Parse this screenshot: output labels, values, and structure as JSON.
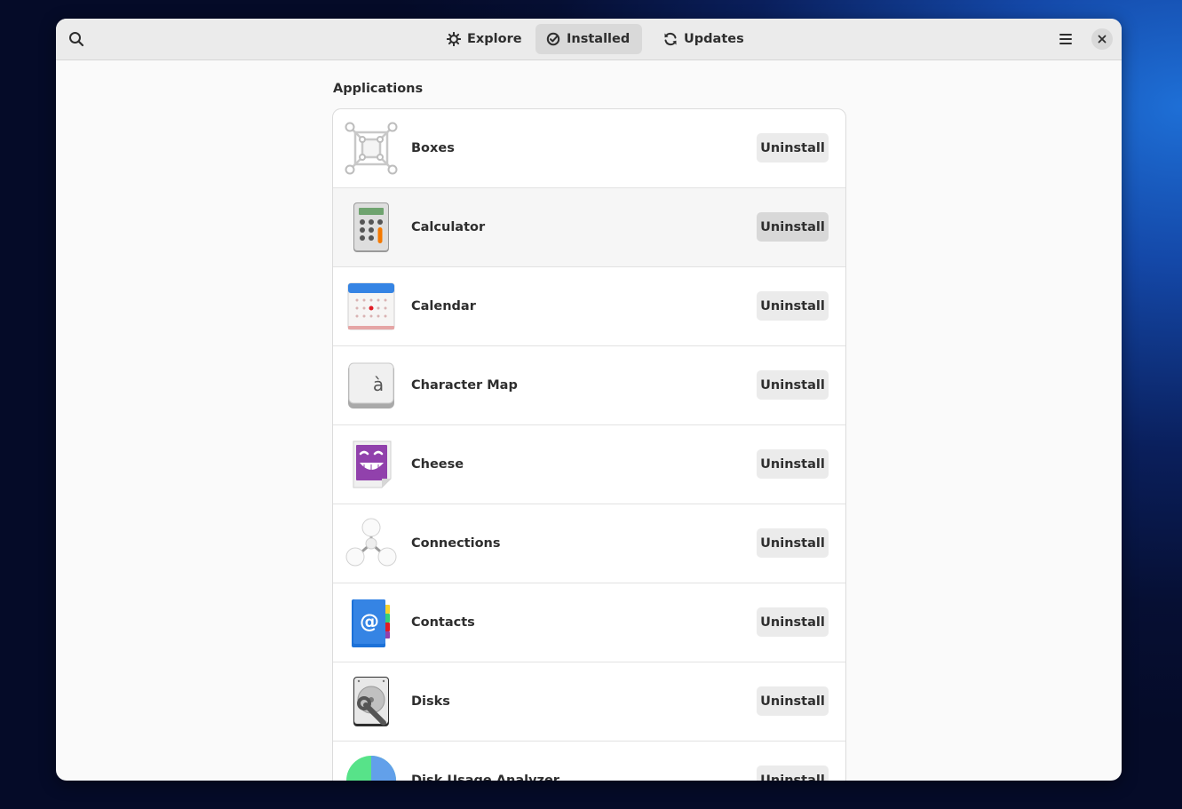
{
  "header": {
    "tabs": [
      {
        "label": "Explore",
        "icon": "explore-icon"
      },
      {
        "label": "Installed",
        "icon": "installed-check-icon",
        "active": true
      },
      {
        "label": "Updates",
        "icon": "updates-refresh-icon"
      }
    ]
  },
  "main": {
    "section_title": "Applications",
    "apps": [
      {
        "name": "Boxes",
        "button": "Uninstall",
        "icon": "boxes-icon"
      },
      {
        "name": "Calculator",
        "button": "Uninstall",
        "icon": "calculator-icon"
      },
      {
        "name": "Calendar",
        "button": "Uninstall",
        "icon": "calendar-icon"
      },
      {
        "name": "Character Map",
        "button": "Uninstall",
        "icon": "character-map-icon",
        "icon_glyph": "à"
      },
      {
        "name": "Cheese",
        "button": "Uninstall",
        "icon": "cheese-icon"
      },
      {
        "name": "Connections",
        "button": "Uninstall",
        "icon": "connections-icon"
      },
      {
        "name": "Contacts",
        "button": "Uninstall",
        "icon": "contacts-icon",
        "icon_glyph": "@"
      },
      {
        "name": "Disks",
        "button": "Uninstall",
        "icon": "disks-icon"
      },
      {
        "name": "Disk Usage Analyzer",
        "button": "Uninstall",
        "icon": "disk-usage-analyzer-icon"
      }
    ]
  },
  "colors": {
    "accent_blue": "#3584e4",
    "calculator_orange": "#f57900",
    "cheese_purple": "#9141ac"
  }
}
